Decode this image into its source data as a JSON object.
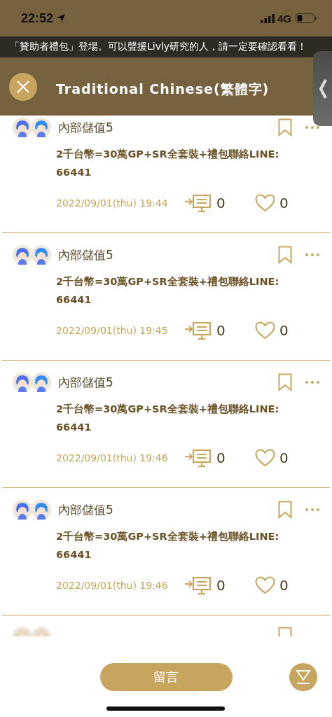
{
  "status_bar": {
    "time": "22:52",
    "network": "4G"
  },
  "ticker": {
    "text": "「贊助者禮包」登場。可以聲援Livly研究的人，請一定要確認看看！"
  },
  "header": {
    "title": "Traditional Chinese(繁體字)"
  },
  "posts": [
    {
      "author": "內部儲值5",
      "body": "2千台幣=30萬GP+SR全套裝+禮包聯絡LINE: 66441",
      "date": "2022/09/01(thu) 19:44",
      "comments": "0",
      "likes": "0"
    },
    {
      "author": "內部儲值5",
      "body": "2千台幣=30萬GP+SR全套裝+禮包聯絡LINE: 66441",
      "date": "2022/09/01(thu) 19:45",
      "comments": "0",
      "likes": "0"
    },
    {
      "author": "內部儲值5",
      "body": "2千台幣=30萬GP+SR全套裝+禮包聯絡LINE: 66441",
      "date": "2022/09/01(thu) 19:46",
      "comments": "0",
      "likes": "0"
    },
    {
      "author": "內部儲值5",
      "body": "2千台幣=30萬GP+SR全套裝+禮包聯絡LINE: 66441",
      "date": "2022/09/01(thu) 19:46",
      "comments": "0",
      "likes": "0"
    }
  ],
  "comment_button": {
    "label": "留言"
  }
}
